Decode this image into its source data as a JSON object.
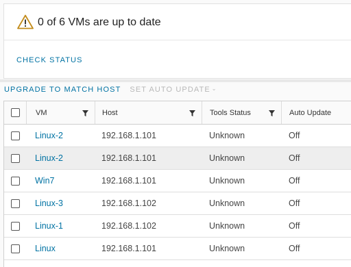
{
  "summary": {
    "title": "0 of 6 VMs are up to date",
    "action": "CHECK STATUS"
  },
  "toolbar": {
    "upgrade_label": "UPGRADE TO MATCH HOST",
    "auto_update_label": "SET AUTO UPDATE",
    "auto_update_caret": "⌄"
  },
  "table": {
    "columns": [
      "VM",
      "Host",
      "Tools Status",
      "Auto Update"
    ],
    "rows": [
      {
        "vm": "Linux-2",
        "host": "192.168.1.101",
        "tools_status": "Unknown",
        "auto_update": "Off"
      },
      {
        "vm": "Linux-2",
        "host": "192.168.1.101",
        "tools_status": "Unknown",
        "auto_update": "Off"
      },
      {
        "vm": "Win7",
        "host": "192.168.1.101",
        "tools_status": "Unknown",
        "auto_update": "Off"
      },
      {
        "vm": "Linux-3",
        "host": "192.168.1.102",
        "tools_status": "Unknown",
        "auto_update": "Off"
      },
      {
        "vm": "Linux-1",
        "host": "192.168.1.102",
        "tools_status": "Unknown",
        "auto_update": "Off"
      },
      {
        "vm": "Linux",
        "host": "192.168.1.101",
        "tools_status": "Unknown",
        "auto_update": "Off"
      }
    ]
  },
  "colors": {
    "accent": "#0072a3",
    "warning": "#c28b1a"
  }
}
